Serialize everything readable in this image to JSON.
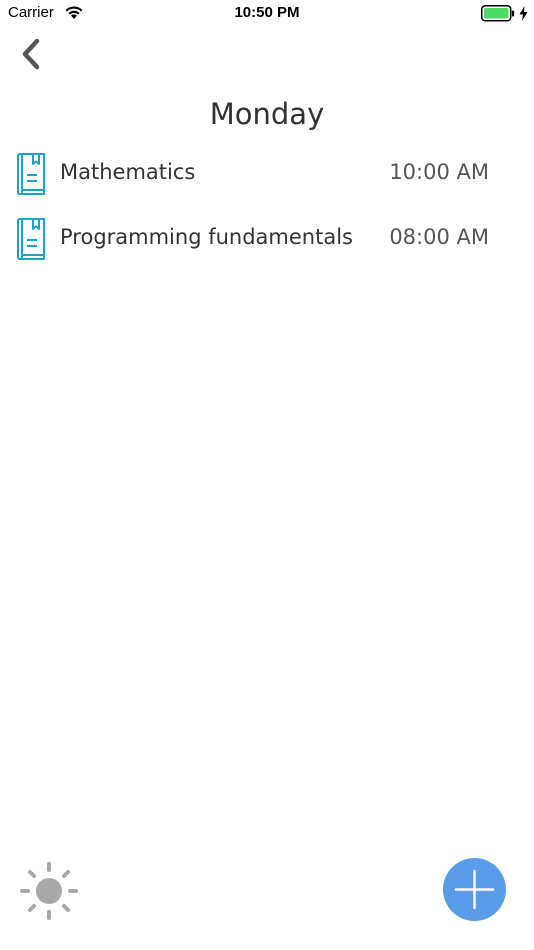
{
  "status_bar": {
    "carrier": "Carrier",
    "time": "10:50 PM",
    "wifi_icon": "wifi-icon",
    "battery_icon": "battery-icon",
    "charging_icon": "charging-bolt-icon",
    "battery_color": "#4cd964"
  },
  "navigation": {
    "back_icon": "chevron-left-icon",
    "title": "Monday"
  },
  "classes": [
    {
      "name": "Mathematics",
      "time": "10:00 AM",
      "icon": "book-icon"
    },
    {
      "name": "Programming fundamentals",
      "time": "08:00 AM",
      "icon": "book-icon"
    }
  ],
  "footer": {
    "theme_icon": "sun-icon",
    "add_icon": "plus-icon"
  },
  "colors": {
    "accent": "#1aa3c4",
    "fab": "#5b9ce8",
    "sun": "#a8a8a8"
  }
}
